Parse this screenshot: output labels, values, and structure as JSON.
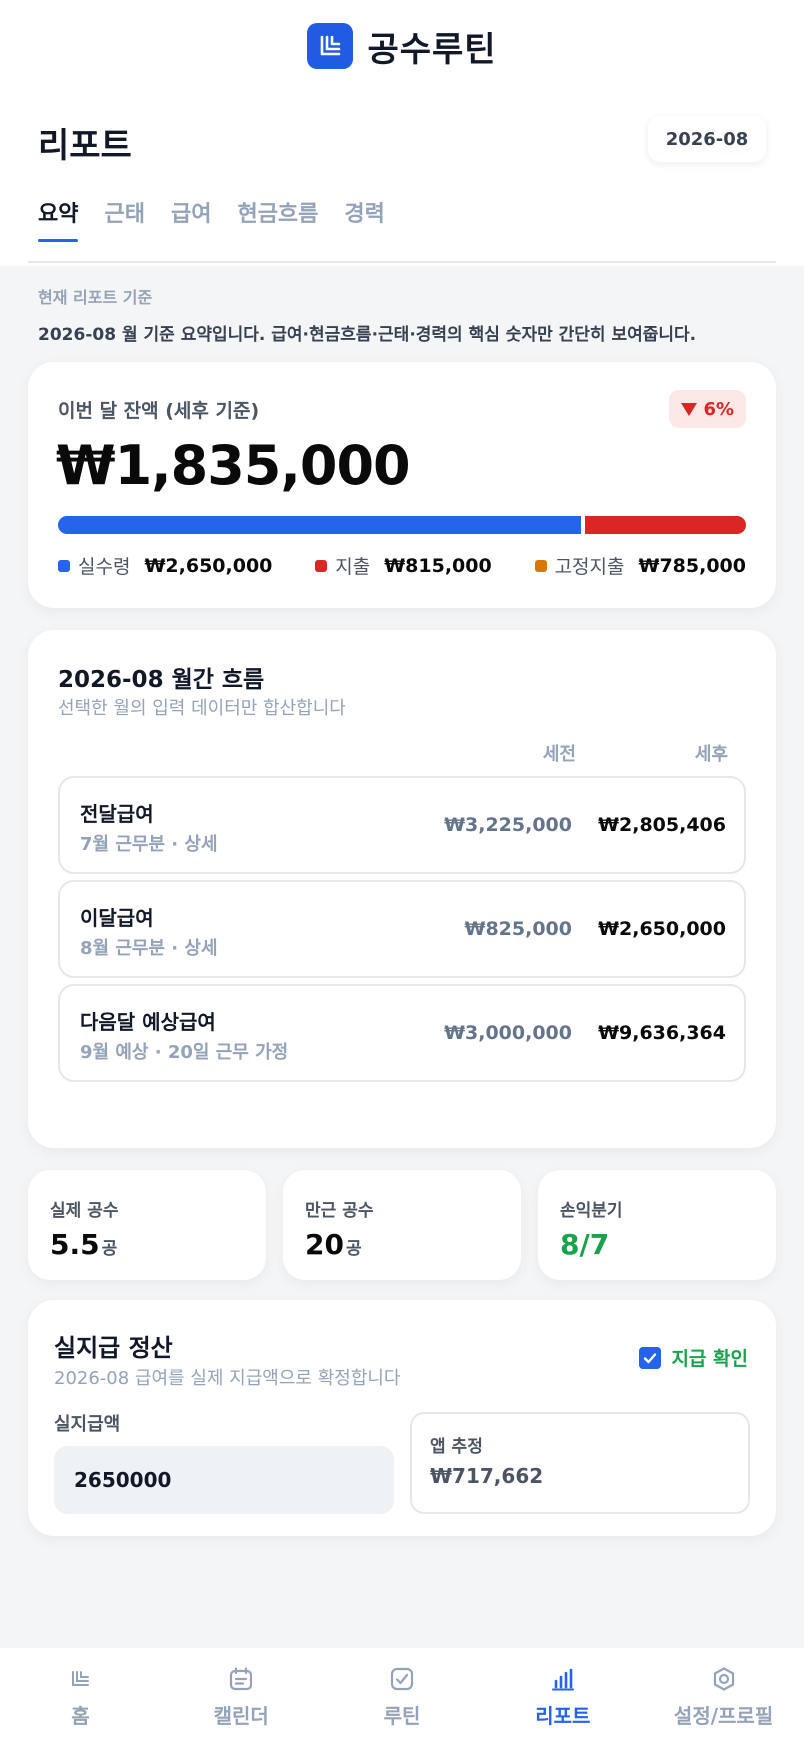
{
  "app": {
    "name": "공수루틴"
  },
  "header": {
    "title": "리포트",
    "month": "2026-08"
  },
  "tabs": [
    {
      "label": "요약",
      "active": true
    },
    {
      "label": "근태",
      "active": false
    },
    {
      "label": "급여",
      "active": false
    },
    {
      "label": "현금흐름",
      "active": false
    },
    {
      "label": "경력",
      "active": false
    }
  ],
  "basis": {
    "label": "현재 리포트 기준",
    "description": "2026-08 월 기준 요약입니다. 급여·현금흐름·근태·경력의 핵심 숫자만 간단히 보여줍니다."
  },
  "balance": {
    "label": "이번 달 잔액 (세후 기준)",
    "amount": "₩1,835,000",
    "change": "6%",
    "change_direction": "down",
    "bar_fractions": {
      "income": 0.765,
      "expense": 0.235
    },
    "legend": [
      {
        "name": "실수령",
        "value": "₩2,650,000",
        "color": "#2563eb"
      },
      {
        "name": "지출",
        "value": "₩815,000",
        "color": "#dc2626"
      },
      {
        "name": "고정지출",
        "value": "₩785,000",
        "color": "#d97706"
      }
    ]
  },
  "flow": {
    "title": "2026-08 월간 흐름",
    "subtitle": "선택한 월의 입력 데이터만 합산합니다",
    "col_pretax": "세전",
    "col_posttax": "세후",
    "rows": [
      {
        "title": "전달급여",
        "sub": "7월 근무분 · 상세",
        "pretax": "₩3,225,000",
        "posttax": "₩2,805,406"
      },
      {
        "title": "이달급여",
        "sub": "8월 근무분 · 상세",
        "pretax": "₩825,000",
        "posttax": "₩2,650,000"
      },
      {
        "title": "다음달 예상급여",
        "sub": "9월 예상 · 20일 근무 가정",
        "pretax": "₩3,000,000",
        "posttax": "₩9,636,364"
      }
    ]
  },
  "stats": [
    {
      "label": "실제 공수",
      "value": "5.5",
      "unit": "공"
    },
    {
      "label": "만근 공수",
      "value": "20",
      "unit": "공"
    },
    {
      "label": "손익분기",
      "value": "8/7",
      "unit": ""
    }
  ],
  "settlement": {
    "title": "실지급 정산",
    "subtitle": "2026-08 급여를 실제 지급액으로 확정합니다",
    "confirm_label": "지급 확인",
    "confirmed": true,
    "pay_label": "실지급액",
    "pay_value": "2650000",
    "estimate_label": "앱 추정",
    "estimate_value": "₩717,662"
  },
  "nav": [
    {
      "label": "홈",
      "icon": "home-icon",
      "active": false
    },
    {
      "label": "캘린더",
      "icon": "calendar-icon",
      "active": false
    },
    {
      "label": "루틴",
      "icon": "routine-icon",
      "active": false
    },
    {
      "label": "리포트",
      "icon": "chart-icon",
      "active": true
    },
    {
      "label": "설정/프로필",
      "icon": "settings-icon",
      "active": false
    }
  ]
}
